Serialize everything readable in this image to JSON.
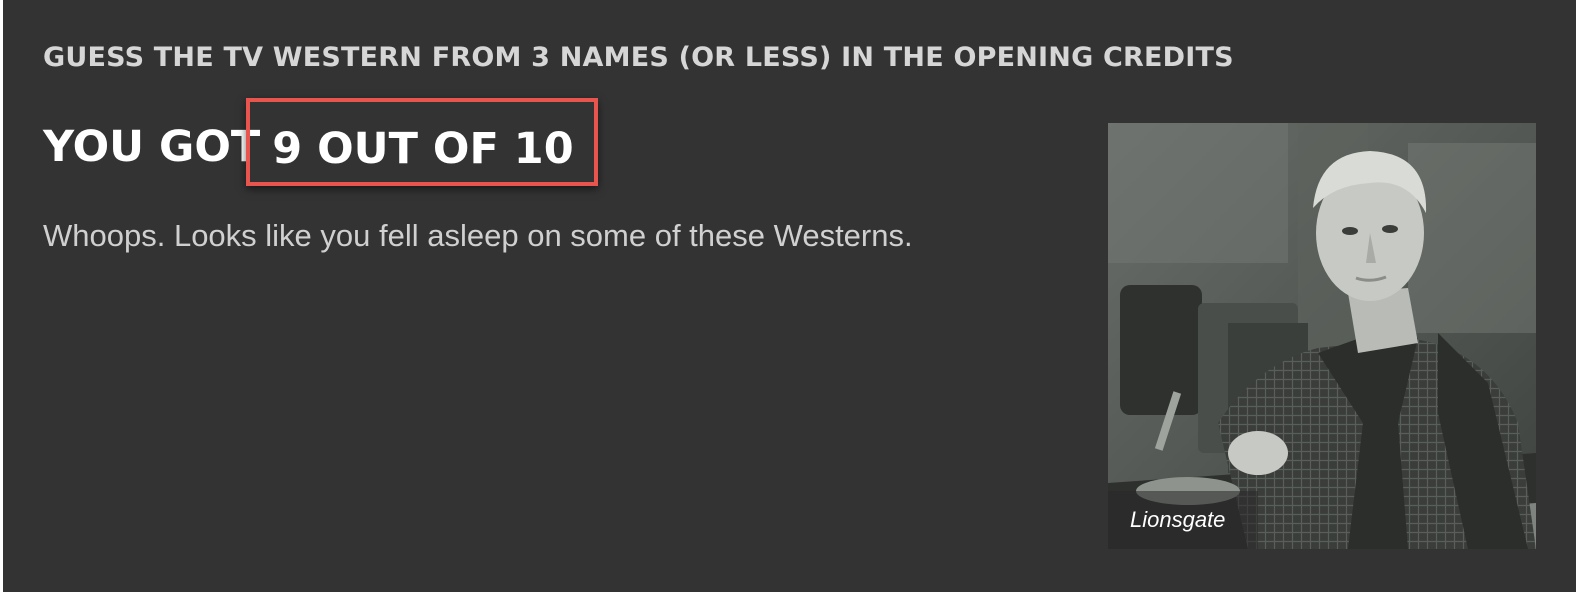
{
  "quiz": {
    "title": "GUESS THE TV WESTERN FROM 3 NAMES (OR LESS) IN THE OPENING CREDITS"
  },
  "result": {
    "prefix": "YOU GOT",
    "score_text": "9 OUT OF 10",
    "message": "Whoops. Looks like you fell asleep on some of these Westerns."
  },
  "image": {
    "credit": "Lionsgate"
  },
  "colors": {
    "background": "#333333",
    "highlight_border": "#e8554e",
    "heading": "#ffffff",
    "title": "#d6d6d6"
  }
}
